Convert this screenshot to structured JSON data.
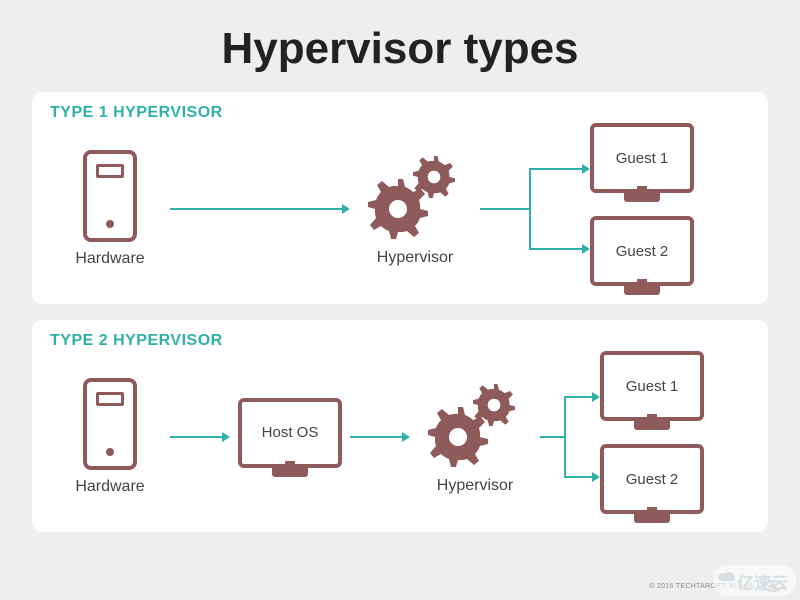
{
  "title": "Hypervisor types",
  "panels": [
    {
      "heading": "TYPE 1 HYPERVISOR",
      "nodes": {
        "hardware": "Hardware",
        "hypervisor": "Hypervisor",
        "guest1": "Guest 1",
        "guest2": "Guest 2"
      }
    },
    {
      "heading": "TYPE 2 HYPERVISOR",
      "nodes": {
        "hardware": "Hardware",
        "host_os": "Host OS",
        "hypervisor": "Hypervisor",
        "guest1": "Guest 1",
        "guest2": "Guest 2"
      }
    }
  ],
  "footer": {
    "copyright": "© 2016 TECHTARGET. ALL RI"
  },
  "watermark": "亿速云",
  "colors": {
    "accent": "#2fb1a9",
    "shape": "#8e5a5a",
    "bg": "#eeeeee",
    "panel": "#ffffff"
  },
  "icons": {
    "tower": "computer-tower-icon",
    "gears": "gears-icon",
    "monitor": "monitor-icon",
    "eye": "eye-icon",
    "cloud": "cloud-icon"
  }
}
